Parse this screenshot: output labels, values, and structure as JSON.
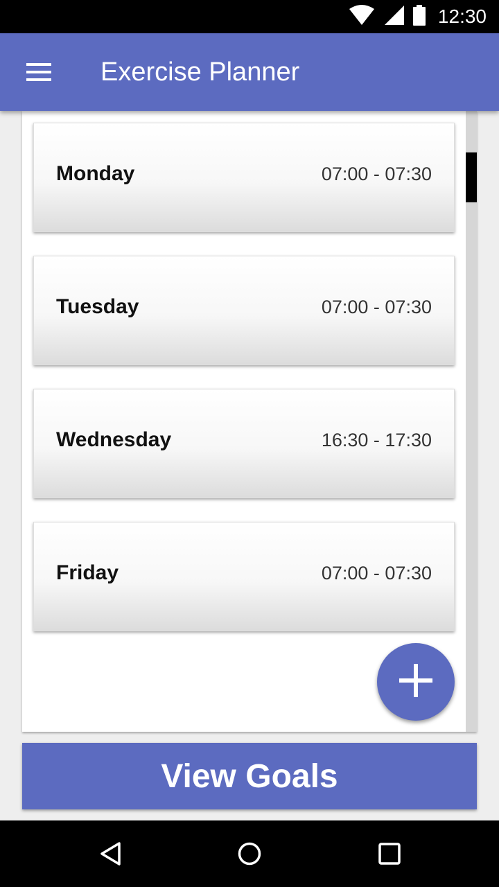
{
  "status_bar": {
    "time": "12:30",
    "icons": [
      "wifi-icon",
      "cell-signal-icon",
      "battery-icon"
    ]
  },
  "app_bar": {
    "menu_icon": "hamburger-menu-icon",
    "title": "Exercise Planner"
  },
  "schedule": {
    "items": [
      {
        "day": "Monday",
        "time": "07:00 - 07:30"
      },
      {
        "day": "Tuesday",
        "time": "07:00 - 07:30"
      },
      {
        "day": "Wednesday",
        "time": "16:30 - 17:30"
      },
      {
        "day": "Friday",
        "time": "07:00 - 07:30"
      }
    ]
  },
  "fab": {
    "icon": "plus-icon"
  },
  "goals_button": {
    "label": "View Goals"
  },
  "nav_bar": {
    "icons": [
      "back-icon",
      "home-icon",
      "recents-icon"
    ]
  },
  "colors": {
    "primary": "#5c6bc0",
    "status_bar": "#000000",
    "card_text": "#111111"
  }
}
